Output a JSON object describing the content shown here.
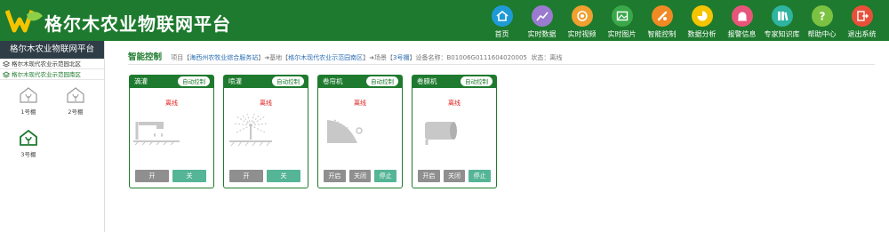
{
  "app": {
    "title": "格尔木农业物联网平台"
  },
  "nav": [
    {
      "label": "首页",
      "icon": "home-icon",
      "color": "#1e9ad6"
    },
    {
      "label": "实时数据",
      "icon": "chart-icon",
      "color": "#9b7bd0"
    },
    {
      "label": "实时视频",
      "icon": "camera-icon",
      "color": "#f0a030"
    },
    {
      "label": "实时图片",
      "icon": "image-icon",
      "color": "#3aa84a"
    },
    {
      "label": "智能控制",
      "icon": "control-icon",
      "color": "#f08a24"
    },
    {
      "label": "数据分析",
      "icon": "pie-icon",
      "color": "#f5c400"
    },
    {
      "label": "报警信息",
      "icon": "alarm-icon",
      "color": "#e8557a"
    },
    {
      "label": "专家知识库",
      "icon": "book-icon",
      "color": "#2eb4a0"
    },
    {
      "label": "帮助中心",
      "icon": "help-icon",
      "color": "#7cc242"
    },
    {
      "label": "退出系统",
      "icon": "logout-icon",
      "color": "#e8503a"
    }
  ],
  "sidebar": {
    "title": "格尔木农业物联网平台",
    "rows": [
      "格尔木现代农业示范园北区",
      "格尔木现代农业示范园南区"
    ],
    "houses": [
      "1号棚",
      "2号棚",
      "3号棚"
    ]
  },
  "breadcrumb": {
    "heading": "智能控制",
    "project_label": "项目【",
    "project": "海西州农牧业综合服务站",
    "base_label": "】➜基地【",
    "base": "格尔木现代农业示范园南区",
    "house_label": "】➜场景【",
    "house": "3号棚",
    "device_label": "】设备名称：",
    "device": "B01006G0111604020005",
    "status_label": "状态：",
    "status": "离线"
  },
  "cards": [
    {
      "name": "滴灌",
      "mode": "自动控制",
      "status": "离线",
      "icon": "drip-irrigation-icon",
      "buttons": [
        "开",
        "关"
      ]
    },
    {
      "name": "喷灌",
      "mode": "自动控制",
      "status": "离线",
      "icon": "sprinkler-icon",
      "buttons": [
        "开",
        "关"
      ]
    },
    {
      "name": "卷帘机",
      "mode": "自动控制",
      "status": "离线",
      "icon": "roller-shutter-icon",
      "buttons": [
        "开启",
        "关闭",
        "停止"
      ]
    },
    {
      "name": "卷膜机",
      "mode": "自动控制",
      "status": "离线",
      "icon": "film-roller-icon",
      "buttons": [
        "开启",
        "关闭",
        "停止"
      ]
    }
  ]
}
